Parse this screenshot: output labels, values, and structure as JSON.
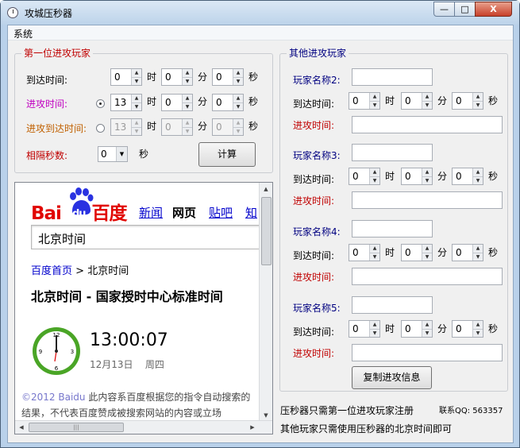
{
  "window": {
    "title": "攻城压秒器",
    "minimize": "—",
    "maximize": "□",
    "close": "X"
  },
  "menu": {
    "system": "系统"
  },
  "first_player": {
    "legend": "第一位进攻玩家",
    "arrival_label": "到达时间:",
    "attack_label": "进攻时间:",
    "attack_arrival_label": "进攻到达时间:",
    "interval_label": "相隔秒数:",
    "hour": "时",
    "minute": "分",
    "second": "秒",
    "arrival": {
      "h": "0",
      "m": "0",
      "s": "0"
    },
    "attack": {
      "h": "13",
      "m": "0",
      "s": "0"
    },
    "attack_arrival": {
      "h": "13",
      "m": "0",
      "s": "0"
    },
    "interval_value": "0",
    "interval_unit": "秒",
    "calc_button": "计算"
  },
  "others": {
    "legend": "其他进攻玩家",
    "arrival_label": "到达时间:",
    "attack_label": "进攻时间:",
    "hour": "时",
    "minute": "分",
    "second": "秒",
    "players": [
      {
        "name_label": "玩家名称2:",
        "h": "0",
        "m": "0",
        "s": "0"
      },
      {
        "name_label": "玩家名称3:",
        "h": "0",
        "m": "0",
        "s": "0"
      },
      {
        "name_label": "玩家名称4:",
        "h": "0",
        "m": "0",
        "s": "0"
      },
      {
        "name_label": "玩家名称5:",
        "h": "0",
        "m": "0",
        "s": "0"
      }
    ],
    "copy_button": "复制进攻信息"
  },
  "browser": {
    "logo_bai": "Bai",
    "logo_du": "du",
    "logo_cn": "百度",
    "nav": [
      "新闻",
      "网页",
      "贴吧",
      "知"
    ],
    "query": "北京时间",
    "crumb_home": "百度首页",
    "crumb_sep": ">",
    "crumb_current": "北京时间",
    "headline": "北京时间  - 国家授时中心标准时间",
    "time": "13:00:07",
    "date": "12月13日",
    "weekday": "周四",
    "footer_prefix": "©2012 Baidu",
    "footer_text": " 此内容系百度根据您的指令自动搜索的结果，不代表百度赞成被搜索网站的内容或立场"
  },
  "notes": {
    "line1": "压秒器只需第一位进攻玩家注册",
    "qq": "联系QQ: 563357",
    "line2": "其他玩家只需使用压秒器的北京时间即可"
  }
}
